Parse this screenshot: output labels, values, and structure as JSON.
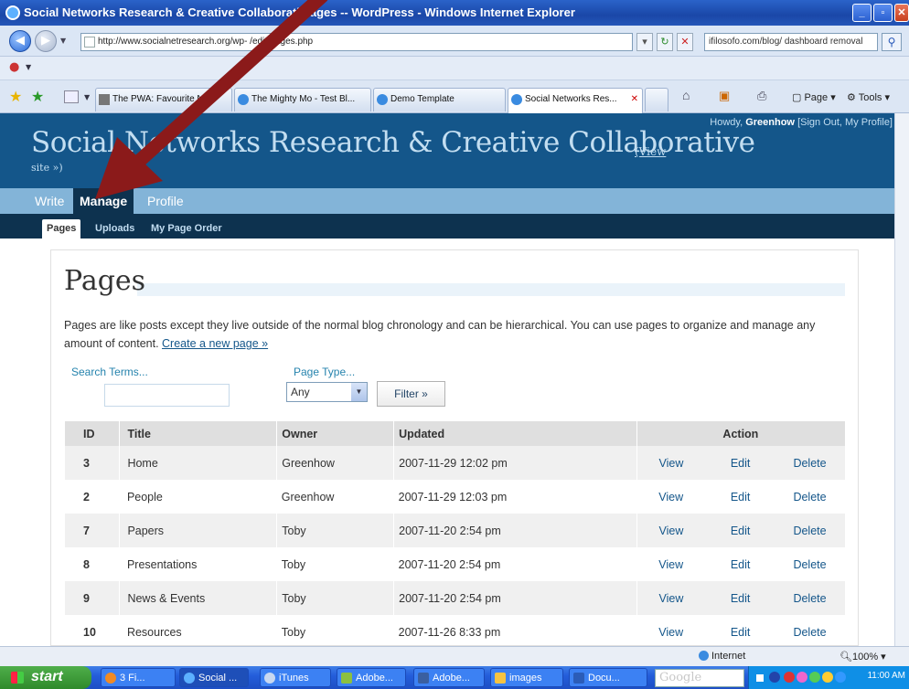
{
  "browser": {
    "window_title": "Social Networks Research & Creative Collaborative - Pages — WordPress - Windows Internet Explorer",
    "window_title_visible": "Social Networks Research & Creative Collaborativ     ages -- WordPress - Windows Internet Explorer",
    "url": "http://www.socialnetresearch.org/wp-     /edit-pages.php",
    "search_text": "ifilosofo.com/blog/ dashboard removal",
    "tabs": [
      {
        "label": "The PWA: Favourite N..."
      },
      {
        "label": "The Mighty Mo - Test Bl..."
      },
      {
        "label": "Demo Template"
      },
      {
        "label": "Social Networks Res..."
      }
    ],
    "commands": {
      "page": "Page",
      "tools": "Tools"
    },
    "status_zone": "Internet",
    "zoom": "100%"
  },
  "wp": {
    "blog_title": "Social Networks Research & Creative Collaborative",
    "view_site_part1": "(View",
    "view_site_part2": "site »)",
    "howdy": "Howdy,",
    "username": "Greenhow",
    "user_links": "[Sign Out, My Profile]",
    "menu": [
      "Write",
      "Manage",
      "Profile"
    ],
    "submenu": [
      "Pages",
      "Uploads",
      "My Page Order"
    ]
  },
  "main": {
    "page_title": "Pages",
    "intro": "Pages are like posts except they live outside of the normal blog chronology and can be hierarchical. You can use pages to organize and manage any amount of content.",
    "create_link": "Create a new page »",
    "search_label": "Search Terms...",
    "search_value": "",
    "page_type_label": "Page Type...",
    "page_type_value": "Any",
    "filter_label": "Filter »"
  },
  "table": {
    "headers": {
      "id": "ID",
      "title": "Title",
      "owner": "Owner",
      "updated": "Updated",
      "action": "Action"
    },
    "rows": [
      {
        "id": "3",
        "title": "Home",
        "owner": "Greenhow",
        "updated": "2007-11-29 12:02 pm",
        "view": "View",
        "edit": "Edit",
        "delete": "Delete"
      },
      {
        "id": "2",
        "title": "People",
        "owner": "Greenhow",
        "updated": "2007-11-29 12:03 pm",
        "view": "View",
        "edit": "Edit",
        "delete": "Delete"
      },
      {
        "id": "7",
        "title": "Papers",
        "owner": "Toby",
        "updated": "2007-11-20 2:54 pm",
        "view": "View",
        "edit": "Edit",
        "delete": "Delete"
      },
      {
        "id": "8",
        "title": "Presentations",
        "owner": "Toby",
        "updated": "2007-11-20 2:54 pm",
        "view": "View",
        "edit": "Edit",
        "delete": "Delete"
      },
      {
        "id": "9",
        "title": "News & Events",
        "owner": "Toby",
        "updated": "2007-11-20 2:54 pm",
        "view": "View",
        "edit": "Edit",
        "delete": "Delete"
      },
      {
        "id": "10",
        "title": "Resources",
        "owner": "Toby",
        "updated": "2007-11-26 8:33 pm",
        "view": "View",
        "edit": "Edit",
        "delete": "Delete"
      }
    ]
  },
  "taskbar": {
    "start": "start",
    "tasks": [
      "3 Fi...",
      "Social ...",
      "iTunes",
      "Adobe...",
      "Adobe...",
      "images",
      "Docu..."
    ],
    "search_placeholder": "Google",
    "clock": "11:00 AM"
  },
  "colors": {
    "wp_header": "#14568a",
    "wp_menu": "#83b4d8",
    "wp_submenu": "#0d324f",
    "arrow": "#8b1a1a"
  }
}
